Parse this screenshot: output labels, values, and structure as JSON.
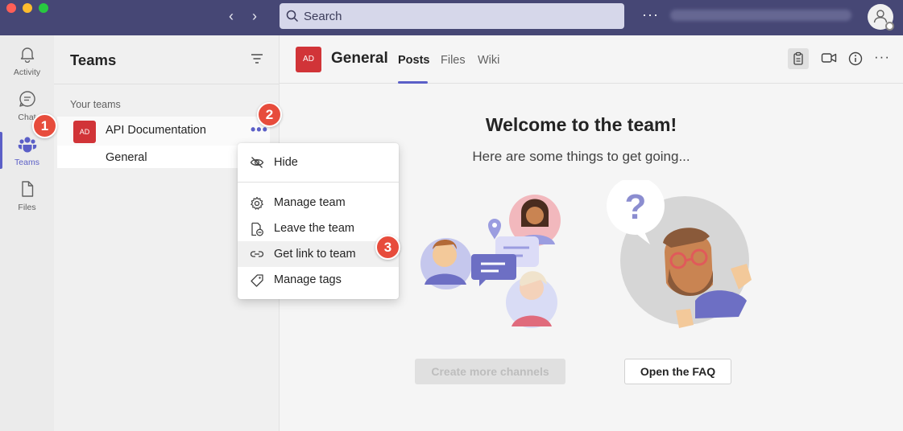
{
  "titlebar": {
    "search_placeholder": "Search",
    "more_label": "···"
  },
  "rail": {
    "items": [
      {
        "label": "Activity",
        "icon": "bell-icon"
      },
      {
        "label": "Chat",
        "icon": "chat-icon"
      },
      {
        "label": "Teams",
        "icon": "teams-icon",
        "active": true
      },
      {
        "label": "Files",
        "icon": "file-icon"
      }
    ]
  },
  "teams_panel": {
    "title": "Teams",
    "section_label": "Your teams",
    "team": {
      "initials": "AD",
      "name": "API Documentation",
      "more": "•••"
    },
    "channel": {
      "name": "General"
    }
  },
  "main": {
    "tile_initials": "AD",
    "channel_title": "General",
    "tabs": [
      {
        "label": "Posts",
        "active": true
      },
      {
        "label": "Files"
      },
      {
        "label": "Wiki"
      }
    ],
    "more_label": "···",
    "welcome_title": "Welcome to the team!",
    "welcome_subtitle": "Here are some things to get going...",
    "create_channels_label": "Create more channels",
    "faq_label": "Open the FAQ"
  },
  "context_menu": {
    "items": [
      {
        "label": "Hide",
        "icon": "eye-hidden-icon"
      },
      {
        "label": "Manage team",
        "icon": "gear-icon"
      },
      {
        "label": "Leave the team",
        "icon": "leave-team-icon"
      },
      {
        "label": "Get link to team",
        "icon": "link-icon",
        "highlighted": true
      },
      {
        "label": "Manage tags",
        "icon": "tag-icon"
      }
    ]
  },
  "badges": [
    "1",
    "2",
    "3"
  ],
  "colors": {
    "titlebar": "#464775",
    "accent": "#5b5fc7",
    "team_tile": "#d13438",
    "badge": "#e74c3c"
  }
}
